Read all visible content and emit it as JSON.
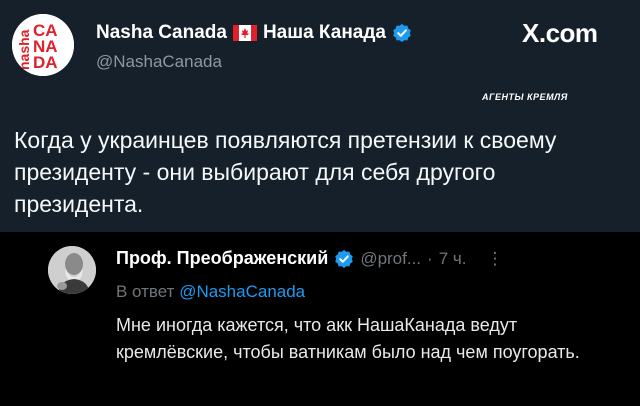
{
  "post": {
    "author_name": "Nasha Canada",
    "author_name_ru": "Наша Канада",
    "handle": "@NashaCanada",
    "source_site": "X.com",
    "watermark": "АГЕНТЫ КРЕМЛЯ",
    "text": "Когда у украинцев появляются претензии к своему президенту - они выбирают для себя другого президента.",
    "avatar_logo": {
      "vertical_text": "nasha",
      "lines": [
        "CA",
        "NA",
        "DA"
      ]
    },
    "flag_icon": "canada-flag-icon"
  },
  "reply": {
    "author_name": "Проф. Преображенский",
    "handle": "@prof...",
    "separator": "·",
    "time": "7 ч.",
    "more": "⋮",
    "reply_to_label": "В ответ",
    "reply_to_handle": "@NashaCanada",
    "text": "Мне иногда кажется, что акк НашаКанада ведут кремлёвские, чтобы ватникам было над чем поугорать."
  },
  "colors": {
    "top_background": "#15202b",
    "reply_background": "#000000",
    "verified_blue": "#1d9bf0",
    "logo_red": "#e0202a",
    "muted_text": "#8b98a5"
  }
}
